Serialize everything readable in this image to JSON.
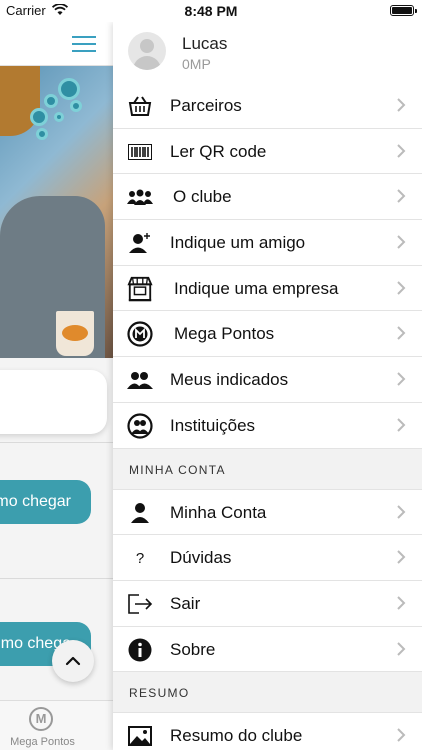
{
  "status_bar": {
    "carrier": "Carrier",
    "time": "8:48 PM"
  },
  "background": {
    "button_1": "mo chegar",
    "button_2": "mo chega",
    "tab_label": "Mega Pontos",
    "tab_icon_letter": "M"
  },
  "drawer": {
    "profile": {
      "name": "Lucas",
      "points": "0MP"
    },
    "main_items": [
      {
        "label": "Parceiros",
        "icon": "basket-icon"
      },
      {
        "label": "Ler QR code",
        "icon": "barcode-icon"
      },
      {
        "label": "O clube",
        "icon": "group-icon"
      },
      {
        "label": "Indique um amigo",
        "icon": "add-user-icon"
      },
      {
        "label": "Indique uma empresa",
        "icon": "store-icon"
      },
      {
        "label": "Mega Pontos",
        "icon": "mega-pontos-icon"
      },
      {
        "label": "Meus indicados",
        "icon": "referrals-icon"
      },
      {
        "label": "Instituições",
        "icon": "institution-icon"
      }
    ],
    "section_account": "MINHA CONTA",
    "account_items": [
      {
        "label": "Minha Conta",
        "icon": "user-icon"
      },
      {
        "label": "Dúvidas",
        "icon": "question-icon"
      },
      {
        "label": "Sair",
        "icon": "logout-icon"
      },
      {
        "label": "Sobre",
        "icon": "info-icon"
      }
    ],
    "section_summary": "RESUMO",
    "summary_items": [
      {
        "label": "Resumo do clube",
        "icon": "image-icon"
      }
    ]
  }
}
